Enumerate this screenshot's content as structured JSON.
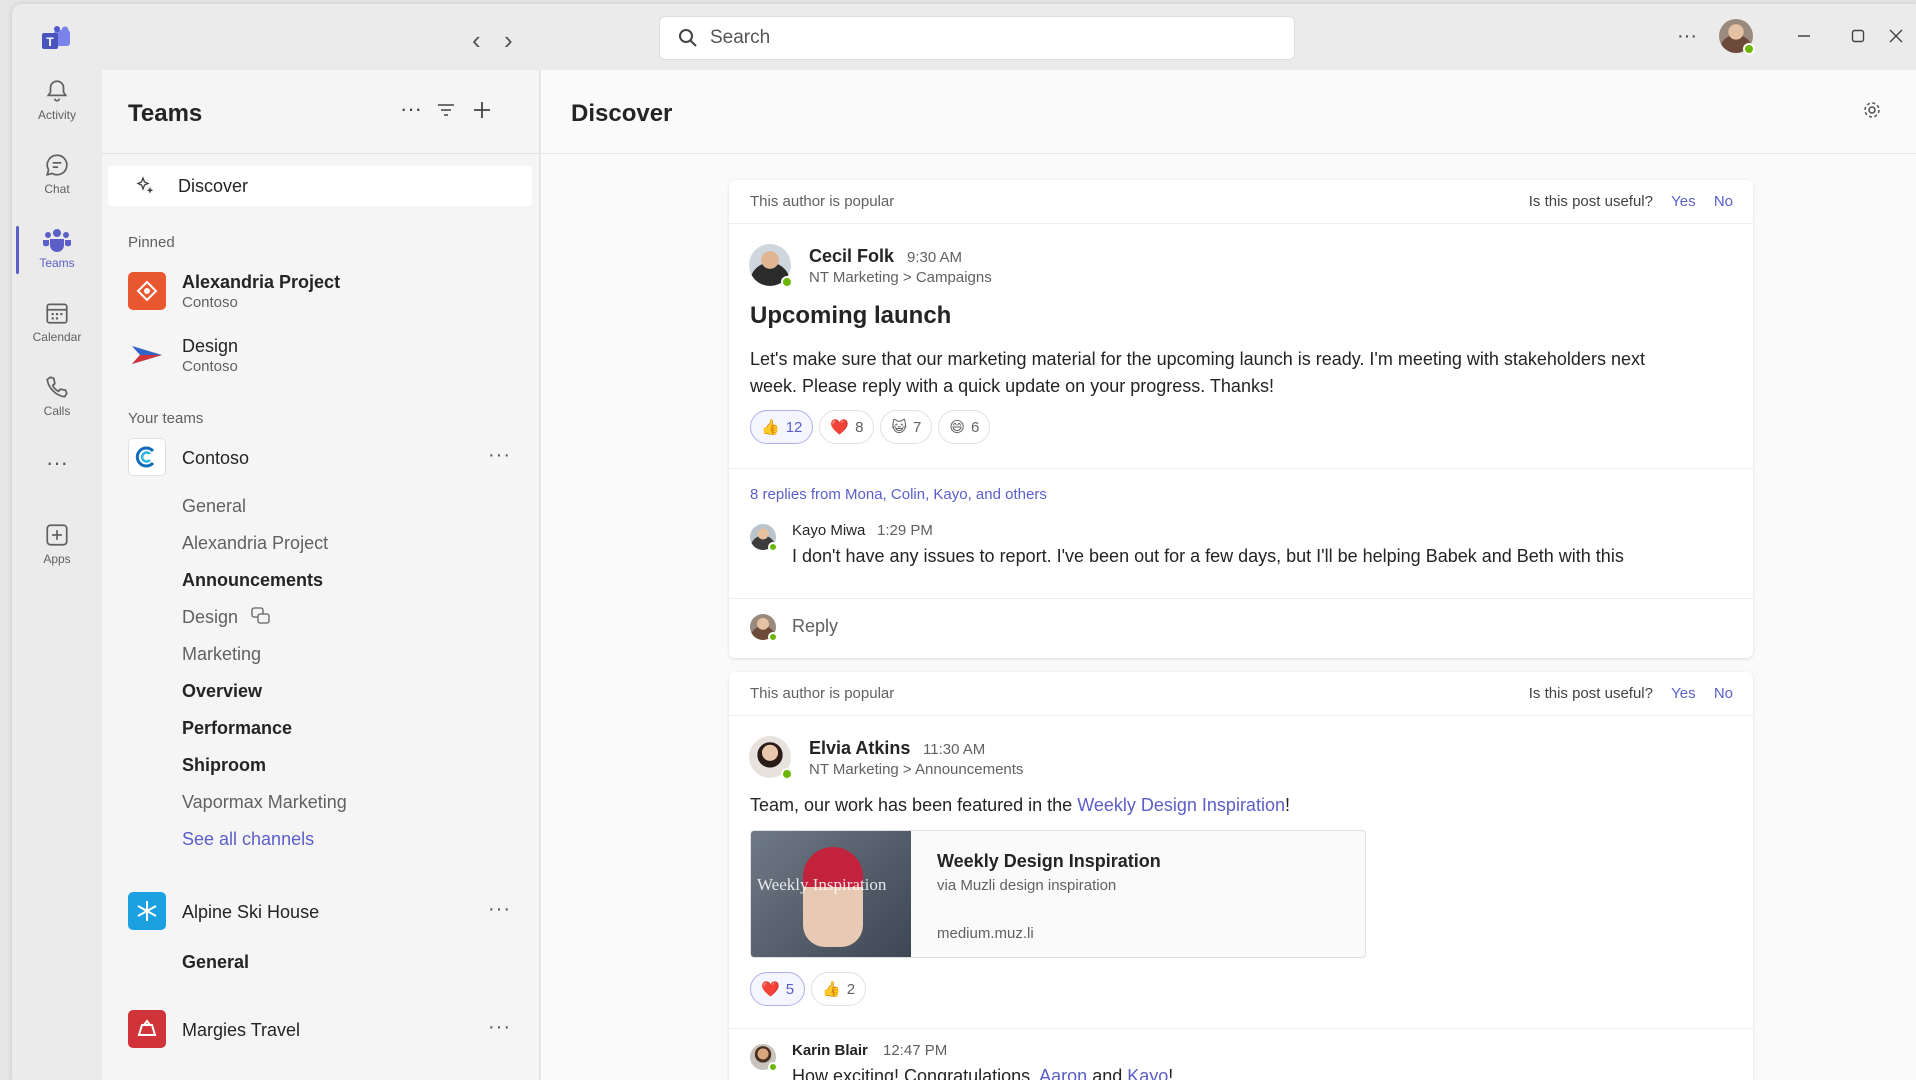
{
  "titlebar": {
    "search_placeholder": "Search",
    "more": "···"
  },
  "rail": {
    "items": [
      {
        "label": "Activity",
        "icon": "bell-icon"
      },
      {
        "label": "Chat",
        "icon": "chat-icon"
      },
      {
        "label": "Teams",
        "icon": "teams-icon",
        "active": true
      },
      {
        "label": "Calendar",
        "icon": "calendar-icon"
      },
      {
        "label": "Calls",
        "icon": "phone-icon"
      },
      {
        "label": "···",
        "icon": "more-icon"
      },
      {
        "label": "Apps",
        "icon": "apps-icon"
      }
    ]
  },
  "teams_pane": {
    "title": "Teams",
    "discover": "Discover",
    "pinned_label": "Pinned",
    "pinned": [
      {
        "name": "Alexandria Project",
        "org": "Contoso",
        "color": "#e8572f"
      },
      {
        "name": "Design",
        "org": "Contoso",
        "color": "#2f63c8"
      }
    ],
    "your_teams_label": "Your teams",
    "teams": [
      {
        "name": "Contoso",
        "channels": [
          {
            "name": "General",
            "bold": false
          },
          {
            "name": "Alexandria Project",
            "bold": false
          },
          {
            "name": "Announcements",
            "bold": true
          },
          {
            "name": "Design",
            "bold": false
          },
          {
            "name": "Marketing",
            "bold": false
          },
          {
            "name": "Overview",
            "bold": true
          },
          {
            "name": "Performance",
            "bold": true
          },
          {
            "name": "Shiproom",
            "bold": true
          },
          {
            "name": "Vapormax Marketing",
            "bold": false
          }
        ],
        "see_all": "See all channels"
      },
      {
        "name": "Alpine Ski House",
        "color": "#1ba1e2",
        "channels": [
          {
            "name": "General",
            "bold": true
          }
        ]
      },
      {
        "name": "Margies Travel",
        "color": "#d13438"
      }
    ],
    "more": "···"
  },
  "main": {
    "title": "Discover",
    "posts": [
      {
        "popular": "This author is popular",
        "useful_q": "Is this post useful?",
        "yes": "Yes",
        "no": "No",
        "author": "Cecil Folk",
        "time": "9:30 AM",
        "breadcrumb": "NT Marketing > Campaigns",
        "title": "Upcoming launch",
        "body_line1": "Let's make sure that our marketing material for the upcoming launch is ready. I'm meeting with stakeholders next",
        "body_line2": "week. Please reply with a quick update on your progress. Thanks!",
        "reactions": [
          {
            "emoji": "👍",
            "count": "12",
            "mine": true
          },
          {
            "emoji": "❤️",
            "count": "8"
          },
          {
            "emoji": "😺",
            "count": "7"
          },
          {
            "emoji": "😄",
            "count": "6"
          }
        ],
        "replies_link": "8 replies from Mona, Colin, Kayo, and others",
        "reply": {
          "author": "Kayo Miwa",
          "time": "1:29 PM",
          "body": "I don't have any issues to report. I've been out for a few days, but I'll be helping Babek and Beth with this"
        },
        "reply_label": "Reply"
      },
      {
        "popular": "This author is popular",
        "useful_q": "Is this post useful?",
        "yes": "Yes",
        "no": "No",
        "author": "Elvia Atkins",
        "time": "11:30 AM",
        "breadcrumb": "NT Marketing > Announcements",
        "body_prefix": "Team, our work has been featured in the ",
        "body_link": "Weekly Design Inspiration",
        "body_suffix": "!",
        "link_card": {
          "thumb_text": "Weekly Inspiration",
          "title": "Weekly Design Inspiration",
          "via": "via Muzli design inspiration",
          "domain": "medium.muz.li"
        },
        "reactions": [
          {
            "emoji": "❤️",
            "count": "5",
            "mine": true
          },
          {
            "emoji": "👍",
            "count": "2"
          }
        ],
        "reply": {
          "author": "Karin Blair",
          "time": "12:47 PM",
          "body_prefix": "How exciting! Congratulations, ",
          "link1": "Aaron",
          "mid": " and ",
          "link2": "Kayo",
          "suffix": "!"
        }
      }
    ]
  }
}
